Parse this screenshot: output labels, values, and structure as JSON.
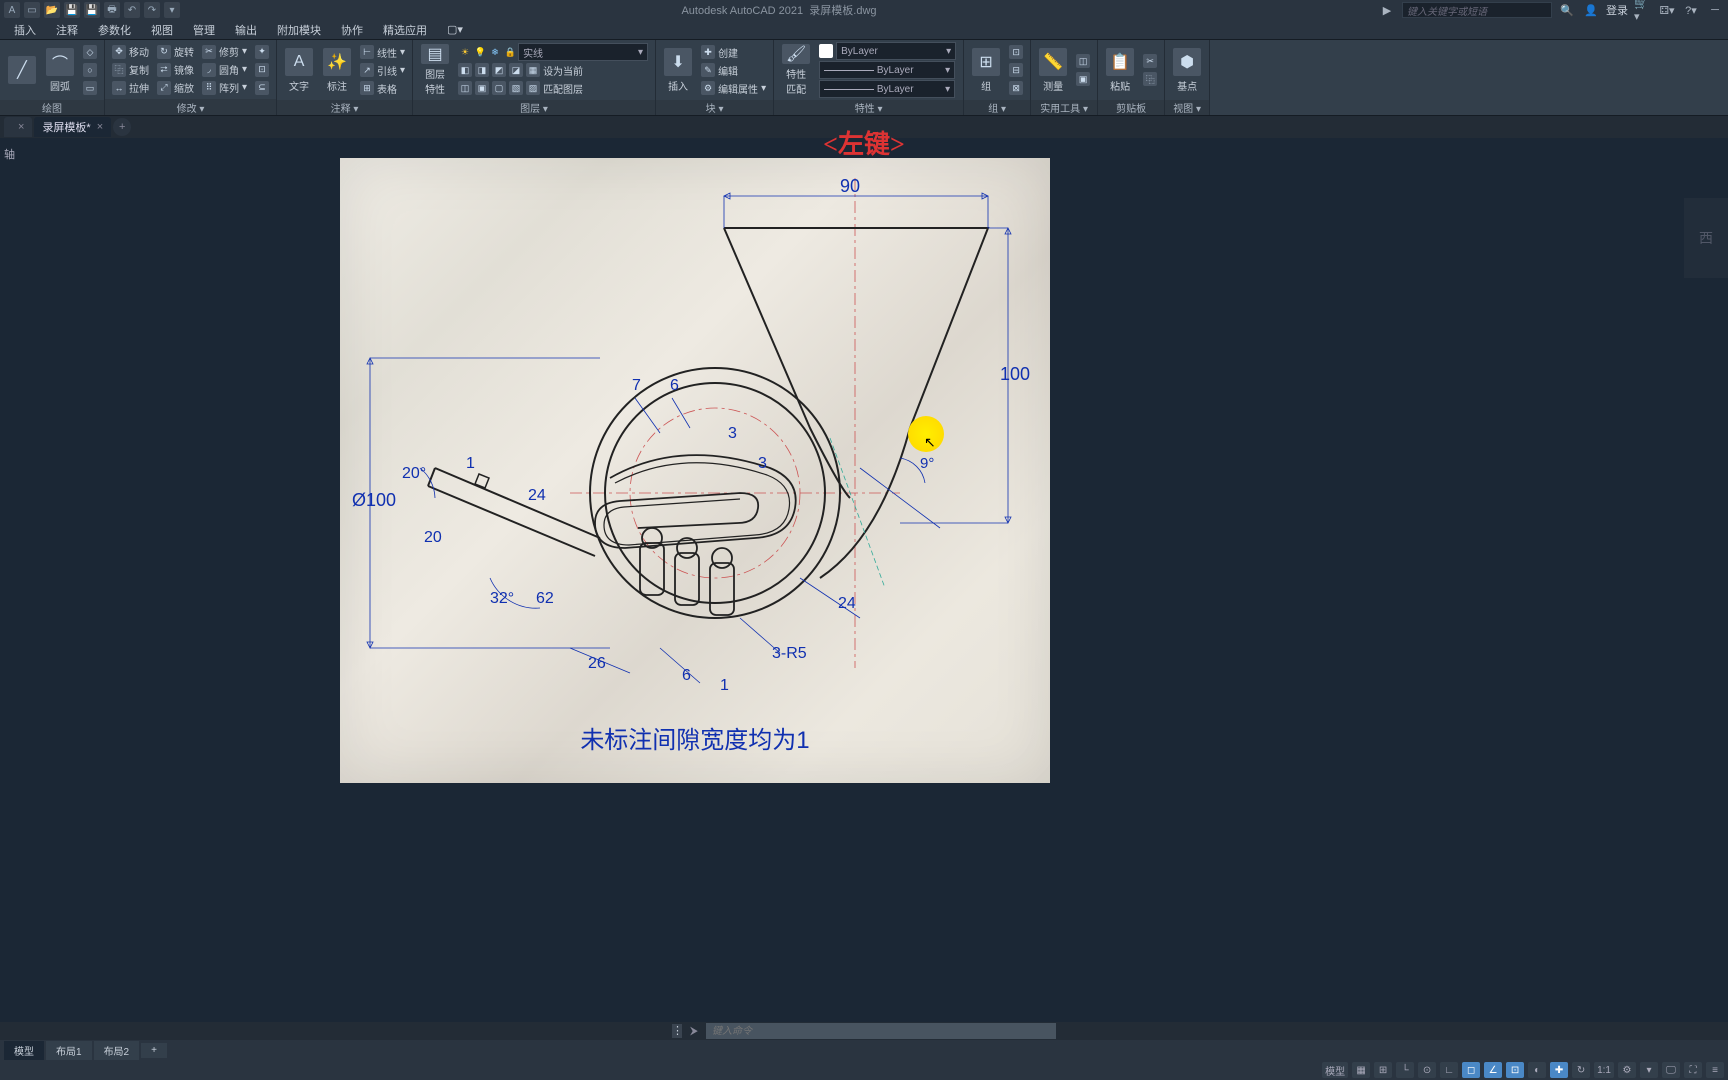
{
  "title": {
    "app": "Autodesk AutoCAD 2021",
    "file": "录屏模板.dwg"
  },
  "search_placeholder": "键入关键字或短语",
  "login": "登录",
  "menus": [
    "插入",
    "注释",
    "参数化",
    "视图",
    "管理",
    "输出",
    "附加模块",
    "协作",
    "精选应用"
  ],
  "ribbon": {
    "draw": {
      "title": "绘图",
      "arc": "圆弧"
    },
    "modify": {
      "title": "修改 ▾",
      "move": "移动",
      "rotate": "旋转",
      "trim": "修剪",
      "copy": "复制",
      "mirror": "镜像",
      "fillet": "圆角",
      "stretch": "拉伸",
      "scale": "缩放",
      "array": "阵列"
    },
    "annot": {
      "title": "注释 ▾",
      "text": "文字",
      "dim": "标注",
      "linear": "线性",
      "leader": "引线",
      "table": "表格"
    },
    "layer": {
      "title": "图层 ▾",
      "props": "图层\n特性",
      "color_items": [
        "●",
        "●",
        "●",
        "●",
        "●"
      ]
    },
    "line": {
      "solid": "实线"
    },
    "block": {
      "title": "块 ▾",
      "insert": "插入",
      "create": "创建",
      "edit": "编辑",
      "attr": "编辑属性",
      "current": "设为当前",
      "match": "匹配图层"
    },
    "props": {
      "title": "特性 ▾",
      "match": "特性\n匹配",
      "bylayer": "ByLayer"
    },
    "group": {
      "title": "组 ▾",
      "group": "组"
    },
    "util": {
      "title": "实用工具 ▾",
      "measure": "测量"
    },
    "clip": {
      "title": "剪贴板",
      "paste": "粘贴"
    },
    "view": {
      "title": "视图 ▾",
      "base": "基点"
    }
  },
  "filetabs": {
    "tab1": "",
    "tab2": "录屏模板*"
  },
  "overlay": "<左键>",
  "sidebar_hint": "轴",
  "viewcube": "西",
  "drawing": {
    "dims": {
      "d90": "90",
      "d100": "100",
      "phi100": "Ø100",
      "a20": "20°",
      "n1a": "1",
      "n1b": "1",
      "n24a": "24",
      "n24b": "24",
      "n20": "20",
      "a32": "32°",
      "n62": "62",
      "n26": "26",
      "n6a": "6",
      "n6b": "6",
      "n7": "7",
      "n3a": "3",
      "n3b": "3",
      "a9": "9°",
      "r5": "3-R5"
    },
    "note": "未标注间隙宽度均为1"
  },
  "cmd_placeholder": "键入命令",
  "modeltabs": {
    "model": "模型",
    "layout1": "布局1",
    "layout2": "布局2"
  },
  "statusbar": {
    "model": "模型",
    "scale": "1:1"
  }
}
